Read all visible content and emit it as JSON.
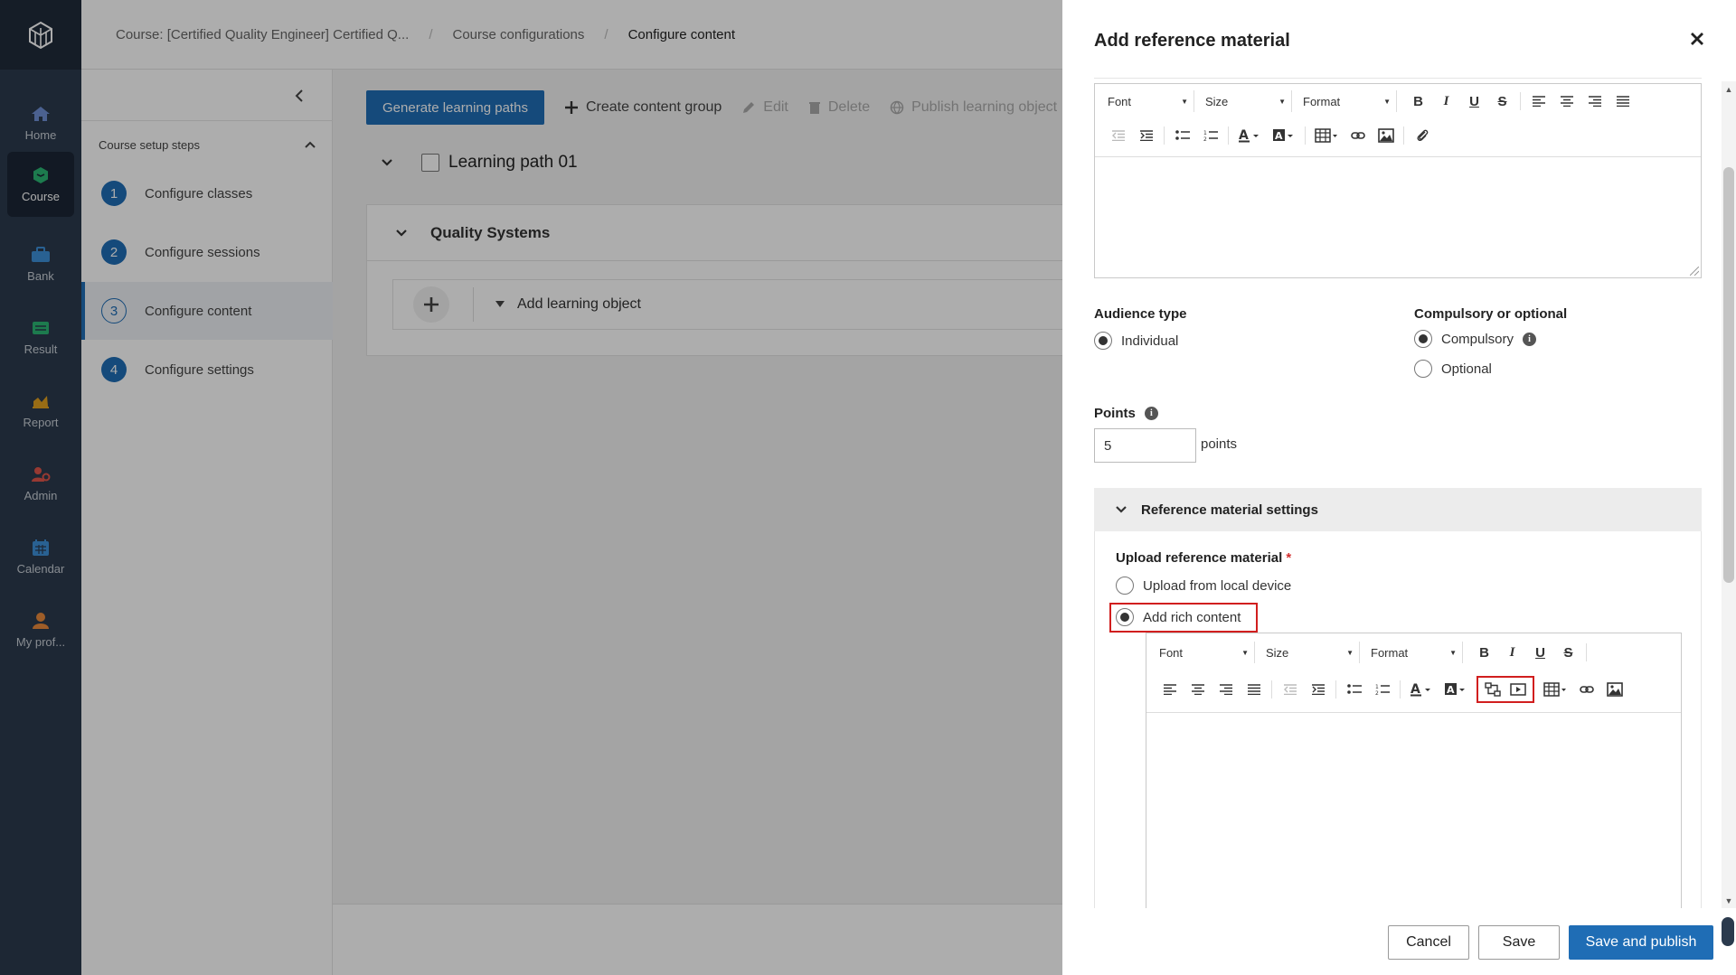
{
  "nav": {
    "items": [
      {
        "label": "Home",
        "icon": "home-icon"
      },
      {
        "label": "Course",
        "icon": "course-icon"
      },
      {
        "label": "Bank",
        "icon": "bank-icon"
      },
      {
        "label": "Result",
        "icon": "result-icon"
      },
      {
        "label": "Report",
        "icon": "report-icon"
      },
      {
        "label": "Admin",
        "icon": "admin-icon"
      },
      {
        "label": "Calendar",
        "icon": "calendar-icon"
      },
      {
        "label": "My prof...",
        "icon": "profile-icon"
      }
    ]
  },
  "breadcrumb": {
    "course": "Course: [Certified Quality Engineer] Certified Q...",
    "config": "Course configurations",
    "current": "Configure content"
  },
  "steps": {
    "title": "Course setup steps",
    "items": [
      {
        "num": "1",
        "label": "Configure classes"
      },
      {
        "num": "2",
        "label": "Configure sessions"
      },
      {
        "num": "3",
        "label": "Configure content"
      },
      {
        "num": "4",
        "label": "Configure settings"
      }
    ]
  },
  "toolbar": {
    "generate": "Generate learning paths",
    "create_group": "Create content group",
    "edit": "Edit",
    "delete": "Delete",
    "publish": "Publish learning object"
  },
  "content": {
    "learning_path": "Learning path 01",
    "group": "Quality Systems",
    "add_lo": "Add learning object"
  },
  "drawer": {
    "title": "Add reference material",
    "editor": {
      "font": "Font",
      "size": "Size",
      "format": "Format"
    },
    "audience": {
      "label": "Audience type",
      "option": "Individual"
    },
    "compulsory": {
      "label": "Compulsory or optional",
      "opt1": "Compulsory",
      "opt2": "Optional"
    },
    "points": {
      "label": "Points",
      "value": "5",
      "unit": "points"
    },
    "section": {
      "title": "Reference material settings"
    },
    "upload": {
      "label": "Upload reference material",
      "required": "*",
      "opt1": "Upload from local device",
      "opt2": "Add rich content"
    },
    "footer": {
      "cancel": "Cancel",
      "save": "Save",
      "save_publish": "Save and publish"
    }
  },
  "colors": {
    "primary": "#1f6db5",
    "rail": "#2b3a4d",
    "highlight": "#d11e1e"
  }
}
